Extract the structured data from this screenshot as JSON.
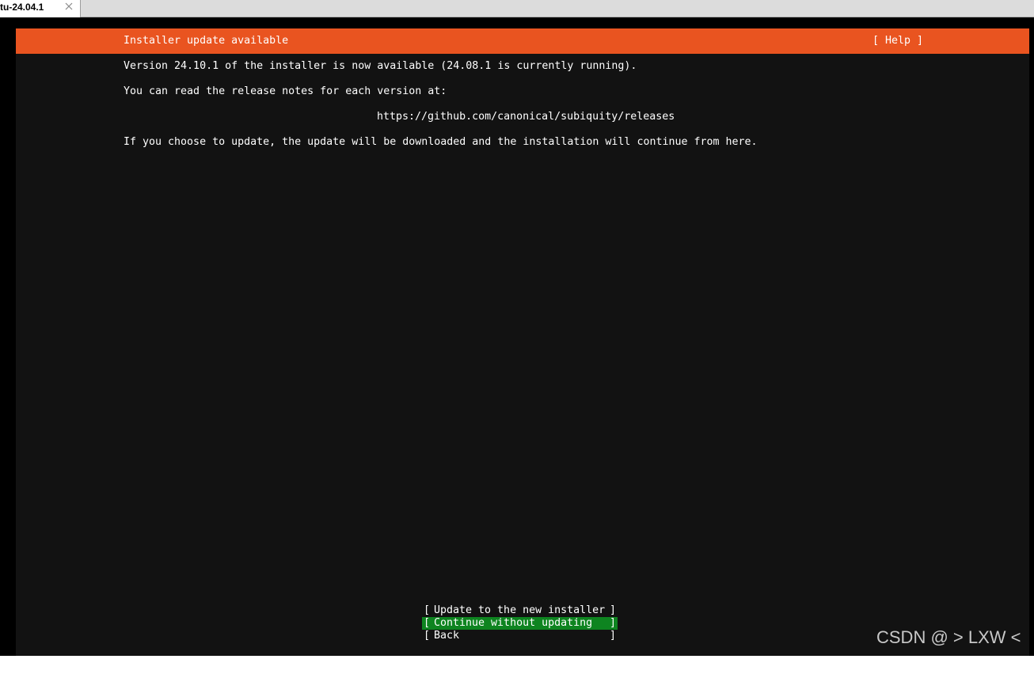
{
  "tab": {
    "label": "tu-24.04.1"
  },
  "header": {
    "title": "Installer update available",
    "help": "[ Help ]"
  },
  "body": {
    "line1": "Version 24.10.1 of the installer is now available (24.08.1 is currently running).",
    "line2": "You can read the release notes for each version at:",
    "url": "https://github.com/canonical/subiquity/releases",
    "line3": "If you choose to update, the update will be downloaded and the installation will continue from here."
  },
  "menu": {
    "items": [
      {
        "label": "Update to the new installer",
        "selected": false
      },
      {
        "label": "Continue without updating",
        "selected": true
      },
      {
        "label": "Back",
        "selected": false
      }
    ]
  },
  "watermark": "CSDN @ > LXW <",
  "colors": {
    "title_bar": "#e95420",
    "screen_bg": "#121212",
    "selected_bg": "#0e8420"
  }
}
